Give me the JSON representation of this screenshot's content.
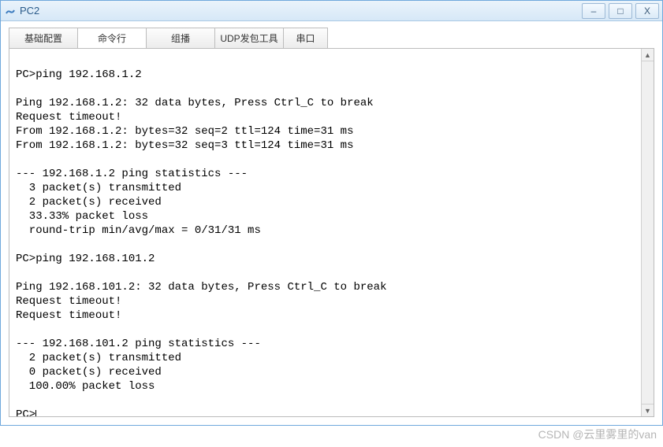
{
  "window": {
    "title": "PC2",
    "icon_name": "app-icon",
    "buttons": {
      "min": "–",
      "max": "□",
      "close": "X"
    }
  },
  "tabs": {
    "items": [
      {
        "label": "基础配置",
        "active": false
      },
      {
        "label": "命令行",
        "active": true
      },
      {
        "label": "组播",
        "active": false
      },
      {
        "label": "UDP发包工具",
        "active": false
      },
      {
        "label": "串口",
        "active": false
      }
    ]
  },
  "terminal": {
    "lines": [
      "",
      "PC>ping 192.168.1.2",
      "",
      "Ping 192.168.1.2: 32 data bytes, Press Ctrl_C to break",
      "Request timeout!",
      "From 192.168.1.2: bytes=32 seq=2 ttl=124 time=31 ms",
      "From 192.168.1.2: bytes=32 seq=3 ttl=124 time=31 ms",
      "",
      "--- 192.168.1.2 ping statistics ---",
      "  3 packet(s) transmitted",
      "  2 packet(s) received",
      "  33.33% packet loss",
      "  round-trip min/avg/max = 0/31/31 ms",
      "",
      "PC>ping 192.168.101.2",
      "",
      "Ping 192.168.101.2: 32 data bytes, Press Ctrl_C to break",
      "Request timeout!",
      "Request timeout!",
      "",
      "--- 192.168.101.2 ping statistics ---",
      "  2 packet(s) transmitted",
      "  0 packet(s) received",
      "  100.00% packet loss",
      ""
    ],
    "prompt": "PC>"
  },
  "watermark": "CSDN @云里雾里的van"
}
